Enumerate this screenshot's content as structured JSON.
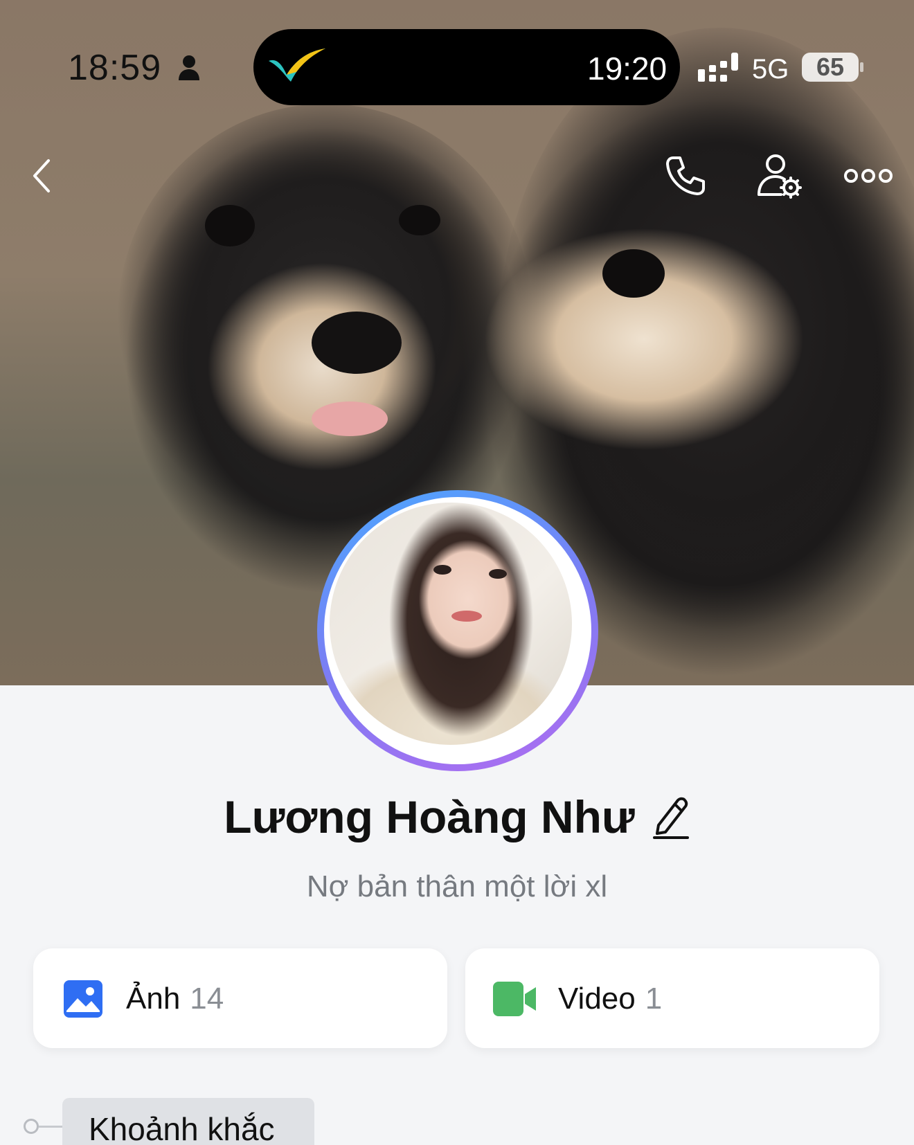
{
  "status_bar": {
    "time_left": "18:59",
    "time_right": "19:20",
    "network": "5G",
    "battery": "65"
  },
  "nav": {
    "back": "back-icon",
    "call": "phone-icon",
    "settings": "user-settings-icon",
    "more": "more-icon"
  },
  "profile": {
    "name": "Lương Hoàng Như",
    "bio": "Nợ bản thân một lời xl"
  },
  "media": {
    "photos": {
      "label": "Ảnh",
      "count": "14",
      "color": "#2f6ef3"
    },
    "videos": {
      "label": "Video",
      "count": "1",
      "color": "#4cb865"
    }
  },
  "timeline": {
    "tab_label": "Khoảnh khắc"
  }
}
